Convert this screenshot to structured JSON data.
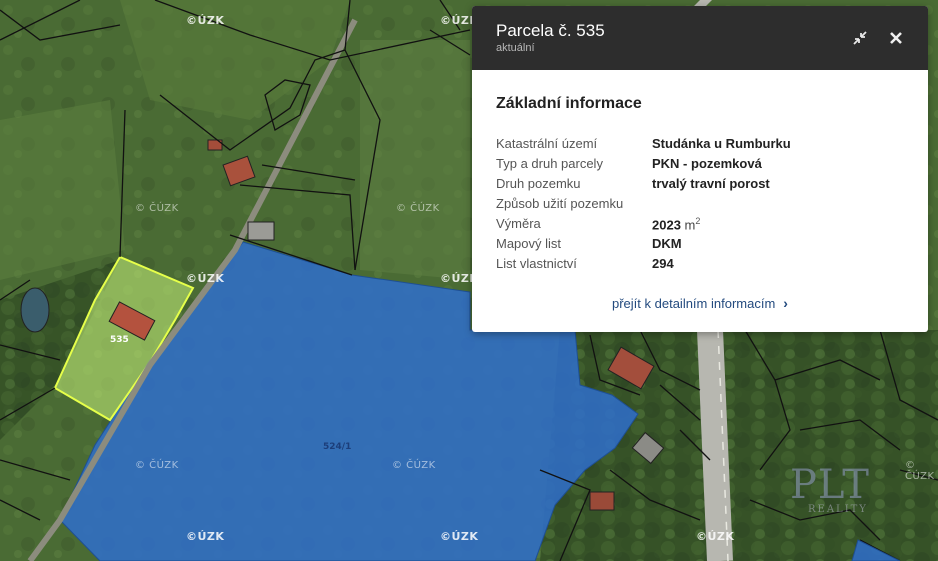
{
  "map": {
    "watermark": "© ČÚZK",
    "watermark_bold": "©ÚZK",
    "parcel_labels": [
      "535",
      "524/1"
    ],
    "logo": {
      "main": "PLT",
      "sub": "REALITY"
    },
    "colors": {
      "selected_parcel": "#c6f27a",
      "highlight_parcel": "#2f6fcc",
      "parcel_border": "#111111"
    }
  },
  "panel": {
    "title": "Parcela č. 535",
    "subtitle": "aktuální",
    "section_title": "Základní informace",
    "rows": [
      {
        "label": "Katastrální území",
        "value": "Studánka u Rumburku"
      },
      {
        "label": "Typ a druh parcely",
        "value": "PKN - pozemková"
      },
      {
        "label": "Druh pozemku",
        "value": "trvalý travní porost"
      },
      {
        "label": "Způsob užití pozemku",
        "value": ""
      },
      {
        "label": "Výměra",
        "value": "2023",
        "unit": "m",
        "unit_sup": "2"
      },
      {
        "label": "Mapový list",
        "value": "DKM"
      },
      {
        "label": "List vlastnictví",
        "value": "294"
      }
    ],
    "detail_link": "přejít k detailním informacím",
    "icons": {
      "collapse": "collapse-arrows-icon",
      "close": "close-icon",
      "chevron": "chevron-right-icon"
    }
  }
}
